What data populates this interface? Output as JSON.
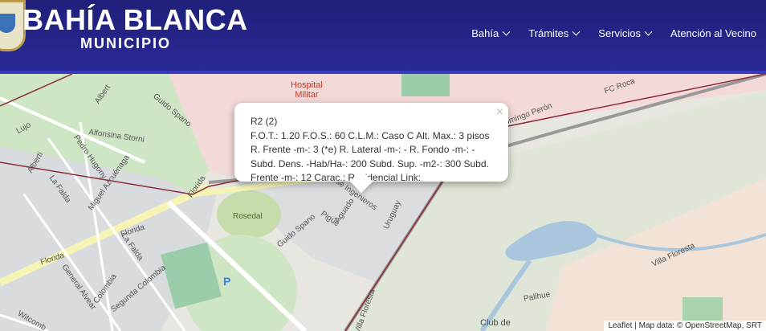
{
  "header": {
    "title": "BAHÍA BLANCA",
    "subtitle": "MUNICIPIO",
    "nav": [
      "Bahía",
      "Trámites",
      "Servicios",
      "Atención al Vecino"
    ]
  },
  "map": {
    "hospital": [
      "Hospital",
      "Militar"
    ],
    "streets": {
      "albert_top": "Albert",
      "guido_spano_1": "Guido Spano",
      "guido_spano_2": "Guido Spano",
      "lujo": "Lujo",
      "alfonsina": "Alfonsina Storni",
      "alberti": "Alberti",
      "pedro_hugony": "Pedro Hugony",
      "la_falda_1": "La Falda",
      "miguel": "Miguel Azcuénaga",
      "florida_1": "Florida",
      "florida_2": "Florida",
      "florida_3": "Florida",
      "la_falda_2": "La Falda",
      "general_alvear": "General Alvear",
      "colombia": "Colombia",
      "segunda_colombia": "Segunda Colombia",
      "witcomb": "Witcomb",
      "rosedal": "Rosedal",
      "pigue": "Pigüé",
      "aguado": "Aguado",
      "jose_ingenieros": "José Ingenieros",
      "uruguay": "Uruguay",
      "fc_roca": "FC Roca",
      "villa_floresta_1": "Villa Floresta",
      "villa_floresta_2": "Villa Floresta",
      "pallhue": "Pallhue",
      "domingo_peron": "Domingo Perón"
    },
    "parking": "P",
    "club": "Club de",
    "attribution": "Leaflet | Map data: © OpenStreetMap, SRT"
  },
  "popup": {
    "lines": [
      "R2 (2)",
      "F.O.T.: 1.20 F.O.S.: 60 C.L.M.: Caso C Alt. Max.: 3 pisos",
      "R. Frente -m-: 3 (*e) R. Lateral -m-: - R. Fondo -m-: -",
      "Subd. Dens. -Hab/Ha-: 200 Subd. Sup. -m2-: 300 Subd.",
      "Frente -m-: 12 Carac.: Residencial Link:"
    ],
    "close": "×"
  }
}
